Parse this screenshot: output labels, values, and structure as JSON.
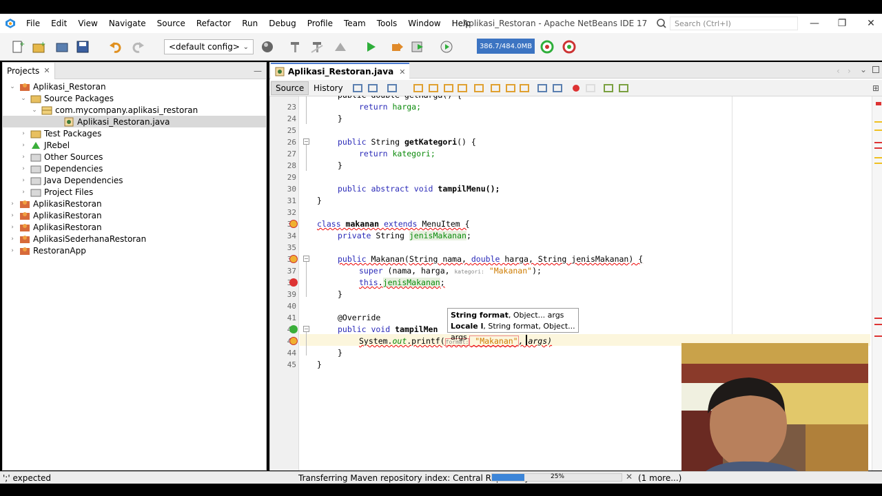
{
  "menu": [
    "File",
    "Edit",
    "View",
    "Navigate",
    "Source",
    "Refactor",
    "Run",
    "Debug",
    "Profile",
    "Team",
    "Tools",
    "Window",
    "Help"
  ],
  "window_title": "Aplikasi_Restoran - Apache NetBeans IDE 17",
  "search_placeholder": "Search (Ctrl+I)",
  "config_label": "<default config>",
  "memory_label": "386.7/484.0MB",
  "projects_tab": "Projects",
  "tree": [
    {
      "label": "Aplikasi_Restoran",
      "arrow": "⌄",
      "icon": "project-icon"
    },
    {
      "label": "Source Packages",
      "arrow": "⌄",
      "icon": "package-folder-icon"
    },
    {
      "label": "com.mycompany.aplikasi_restoran",
      "arrow": "⌄",
      "icon": "package-icon"
    },
    {
      "label": "Aplikasi_Restoran.java",
      "arrow": "",
      "icon": "java-file-icon"
    },
    {
      "label": "Test Packages",
      "arrow": "›",
      "icon": "package-folder-icon"
    },
    {
      "label": "JRebel",
      "arrow": "›",
      "icon": "jrebel-icon"
    },
    {
      "label": "Other Sources",
      "arrow": "›",
      "icon": "folder-icon"
    },
    {
      "label": "Dependencies",
      "arrow": "›",
      "icon": "folder-icon"
    },
    {
      "label": "Java Dependencies",
      "arrow": "›",
      "icon": "folder-icon"
    },
    {
      "label": "Project Files",
      "arrow": "›",
      "icon": "folder-icon"
    },
    {
      "label": "AplikasiRestoran",
      "arrow": "›",
      "icon": "project-icon"
    },
    {
      "label": "AplikasiRestoran",
      "arrow": "›",
      "icon": "project-icon"
    },
    {
      "label": "AplikasiRestoran",
      "arrow": "›",
      "icon": "project-icon"
    },
    {
      "label": "AplikasiSederhanaRestoran",
      "arrow": "›",
      "icon": "project-icon"
    },
    {
      "label": "RestoranApp",
      "arrow": "›",
      "icon": "project-icon"
    }
  ],
  "editor_tab": "Aplikasi_Restoran.java",
  "source_btn": "Source",
  "history_btn": "History",
  "line_numbers": [
    "23",
    "24",
    "25",
    "26",
    "27",
    "28",
    "29",
    "30",
    "31",
    "32",
    "33",
    "34",
    "35",
    "36",
    "37",
    "38",
    "39",
    "40",
    "41",
    "42",
    "43",
    "44",
    "45"
  ],
  "code": {
    "l22": "public double getHarga() {",
    "l23_kw": "return",
    "l23_var": " harga;",
    "l24": "}",
    "l26_a": "public",
    "l26_b": " String ",
    "l26_c": "getKategori",
    "l26_d": "() {",
    "l27_kw": "return",
    "l27_var": " kategori;",
    "l28": "}",
    "l30_a": "public abstract void",
    "l30_b": " tampilMenu();",
    "l31": "}",
    "l33_a": "class",
    "l33_b": " makanan ",
    "l33_c": "extends",
    "l33_d": " MenuItem {",
    "l34_a": "private",
    "l34_b": " String ",
    "l34_c": "jenisMakanan",
    "l34_d": ";",
    "l36_a": "public",
    "l36_b": " Makanan(String nama, ",
    "l36_c": "double",
    "l36_d": " harga, String jenisMakanan) {",
    "l37_a": "super",
    "l37_b": " (nama, harga, ",
    "l37_hint": "kategori:",
    "l37_c": " \"Makanan\"",
    "l37_d": ");",
    "l38_a": "this",
    "l38_b": ".",
    "l38_c": "jenisMakanan",
    "l38_d": ";",
    "l39": "}",
    "l41": "@Override",
    "l42_a": "public void",
    "l42_b": " tampilMen",
    "l43_a": "System.",
    "l43_b": "out",
    "l43_c": ".printf(",
    "l43_hint": "format:",
    "l43_d": " \"Makanan\"",
    "l43_e": ", args)",
    "l44": "}",
    "l45": "}"
  },
  "tooltip": {
    "line1_bold": "String format",
    "line1_rest": ", Object... args",
    "line2_bold": "Locale l",
    "line2_rest": ", String format, Object... args"
  },
  "status": {
    "left": "';' expected",
    "task": "Transferring Maven repository index: Central Repository",
    "percent": "25%",
    "progress": 0.25,
    "more": "(1 more...)"
  },
  "colors": {
    "accent": "#3c74c2",
    "keyword": "#2a2ab8",
    "field": "#0a8a0a",
    "string": "#ce7b00",
    "error": "#e00000"
  }
}
